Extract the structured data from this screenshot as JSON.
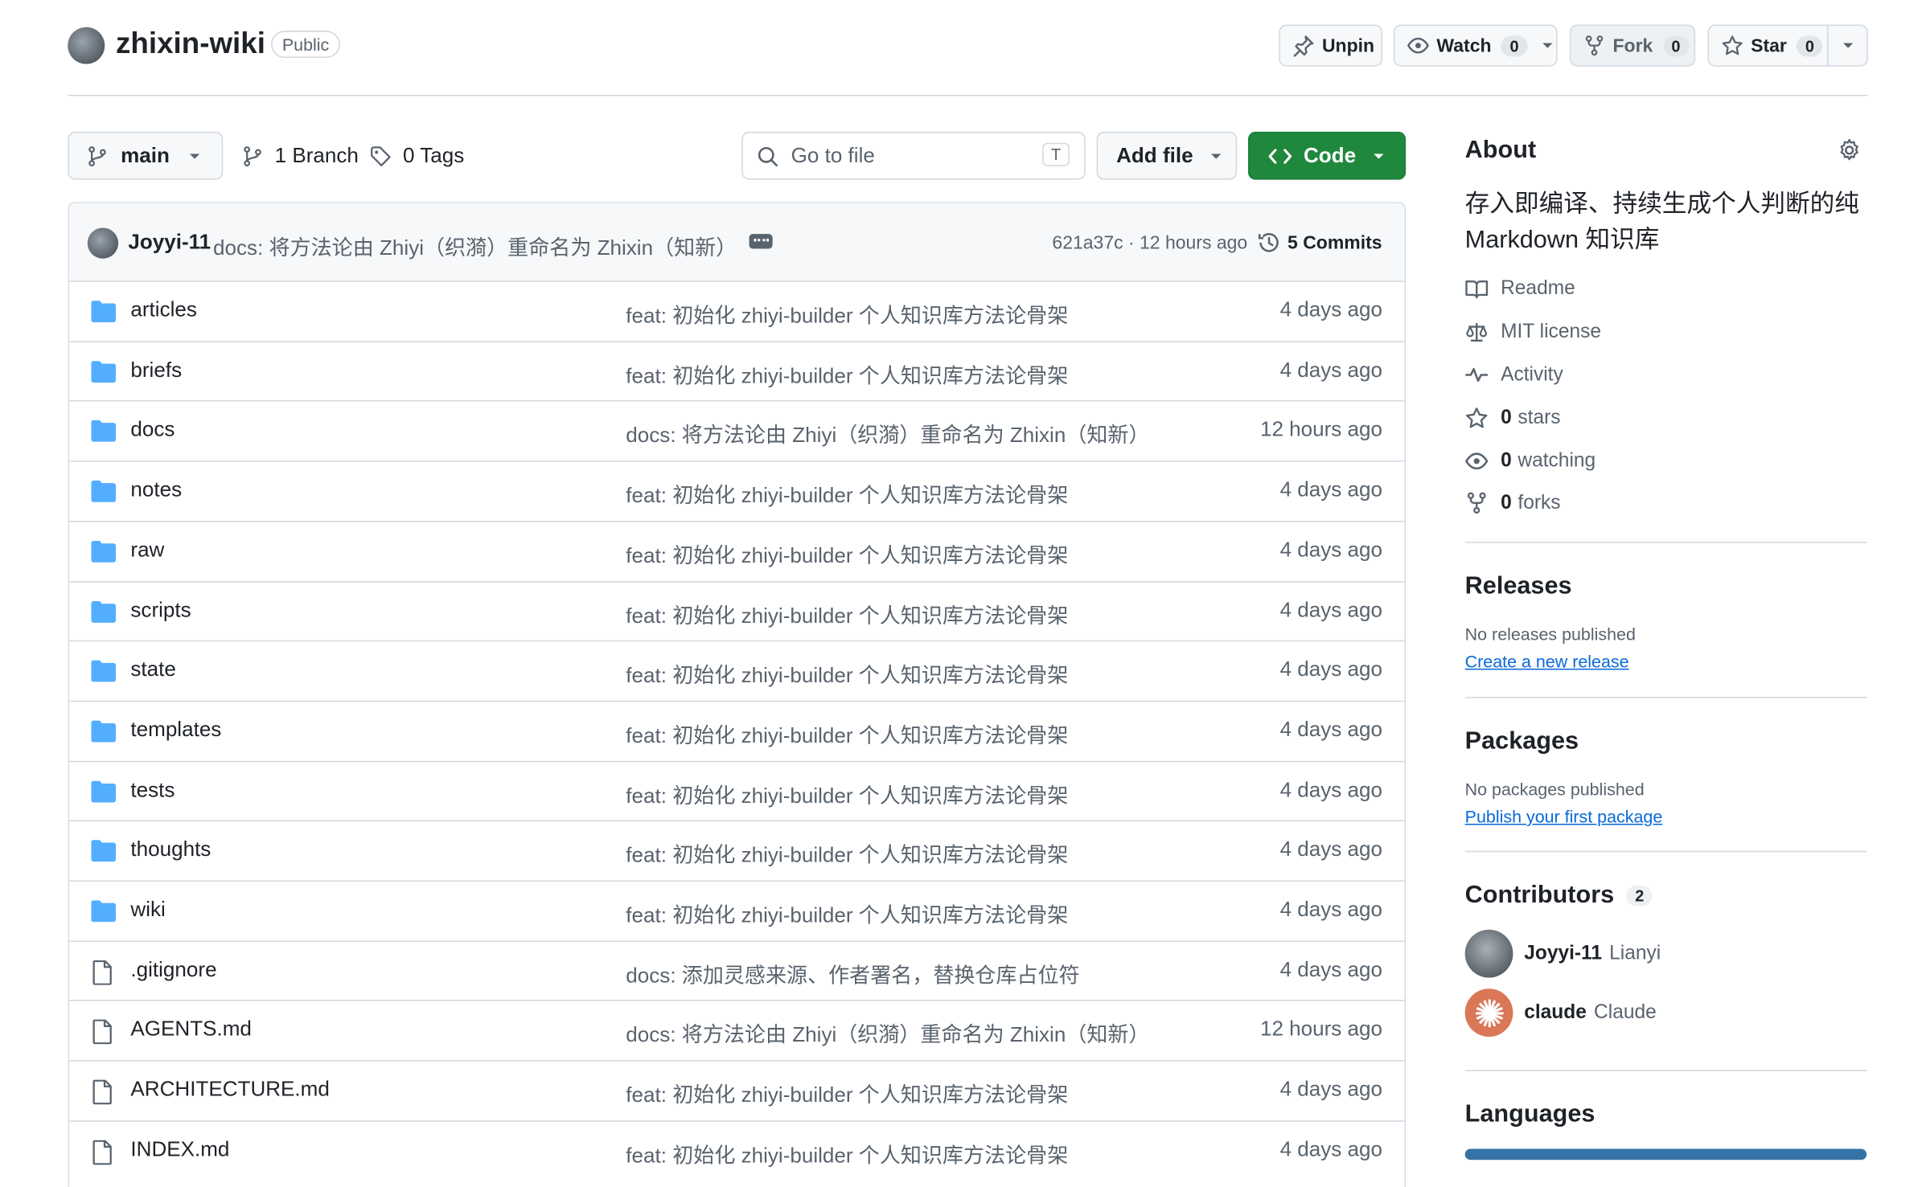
{
  "repo": {
    "name": "zhixin-wiki",
    "visibility": "Public"
  },
  "header_actions": {
    "unpin": "Unpin",
    "watch": {
      "label": "Watch",
      "count": "0"
    },
    "fork": {
      "label": "Fork",
      "count": "0"
    },
    "star": {
      "label": "Star",
      "count": "0"
    }
  },
  "toolbar": {
    "branch": "main",
    "branches": "1 Branch",
    "tags": "0 Tags",
    "go_to_file_placeholder": "Go to file",
    "shortcut_key": "T",
    "add_file": "Add file",
    "code": "Code"
  },
  "latest_commit": {
    "author": "Joyyi-11",
    "message": "docs: 将方法论由 Zhiyi（织漪）重命名为 Zhixin（知新）",
    "hash_time": "621a37c · 12 hours ago",
    "commits": "5 Commits"
  },
  "files": [
    {
      "name": "articles",
      "type": "dir",
      "message": "feat: 初始化 zhiyi-builder 个人知识库方法论骨架",
      "age": "4 days ago"
    },
    {
      "name": "briefs",
      "type": "dir",
      "message": "feat: 初始化 zhiyi-builder 个人知识库方法论骨架",
      "age": "4 days ago"
    },
    {
      "name": "docs",
      "type": "dir",
      "message": "docs: 将方法论由 Zhiyi（织漪）重命名为 Zhixin（知新）",
      "age": "12 hours ago"
    },
    {
      "name": "notes",
      "type": "dir",
      "message": "feat: 初始化 zhiyi-builder 个人知识库方法论骨架",
      "age": "4 days ago"
    },
    {
      "name": "raw",
      "type": "dir",
      "message": "feat: 初始化 zhiyi-builder 个人知识库方法论骨架",
      "age": "4 days ago"
    },
    {
      "name": "scripts",
      "type": "dir",
      "message": "feat: 初始化 zhiyi-builder 个人知识库方法论骨架",
      "age": "4 days ago"
    },
    {
      "name": "state",
      "type": "dir",
      "message": "feat: 初始化 zhiyi-builder 个人知识库方法论骨架",
      "age": "4 days ago"
    },
    {
      "name": "templates",
      "type": "dir",
      "message": "feat: 初始化 zhiyi-builder 个人知识库方法论骨架",
      "age": "4 days ago"
    },
    {
      "name": "tests",
      "type": "dir",
      "message": "feat: 初始化 zhiyi-builder 个人知识库方法论骨架",
      "age": "4 days ago"
    },
    {
      "name": "thoughts",
      "type": "dir",
      "message": "feat: 初始化 zhiyi-builder 个人知识库方法论骨架",
      "age": "4 days ago"
    },
    {
      "name": "wiki",
      "type": "dir",
      "message": "feat: 初始化 zhiyi-builder 个人知识库方法论骨架",
      "age": "4 days ago"
    },
    {
      "name": ".gitignore",
      "type": "file",
      "message": "docs: 添加灵感来源、作者署名，替换仓库占位符",
      "age": "4 days ago"
    },
    {
      "name": "AGENTS.md",
      "type": "file",
      "message": "docs: 将方法论由 Zhiyi（织漪）重命名为 Zhixin（知新）",
      "age": "12 hours ago"
    },
    {
      "name": "ARCHITECTURE.md",
      "type": "file",
      "message": "feat: 初始化 zhiyi-builder 个人知识库方法论骨架",
      "age": "4 days ago"
    },
    {
      "name": "INDEX.md",
      "type": "file",
      "message": "feat: 初始化 zhiyi-builder 个人知识库方法论骨架",
      "age": "4 days ago"
    }
  ],
  "about": {
    "title": "About",
    "description_line1": "存入即编译、持续生成个人判断的纯",
    "description_line2": "Markdown 知识库",
    "readme": "Readme",
    "license": "MIT license",
    "activity": "Activity",
    "stars": {
      "count": "0",
      "label": "stars"
    },
    "watching": {
      "count": "0",
      "label": "watching"
    },
    "forks": {
      "count": "0",
      "label": "forks"
    }
  },
  "releases": {
    "title": "Releases",
    "empty": "No releases published",
    "link": "Create a new release"
  },
  "packages": {
    "title": "Packages",
    "empty": "No packages published",
    "link": "Publish your first package"
  },
  "contributors": {
    "title": "Contributors",
    "count": "2",
    "list": [
      {
        "login": "Joyyi-11",
        "name": "Lianyi"
      },
      {
        "login": "claude",
        "name": "Claude"
      }
    ]
  },
  "languages": {
    "title": "Languages",
    "bar_color": "#3572A5"
  },
  "colors": {
    "accent": "#0969da",
    "code_button": "#1f883d",
    "folder": "#54aeff"
  }
}
